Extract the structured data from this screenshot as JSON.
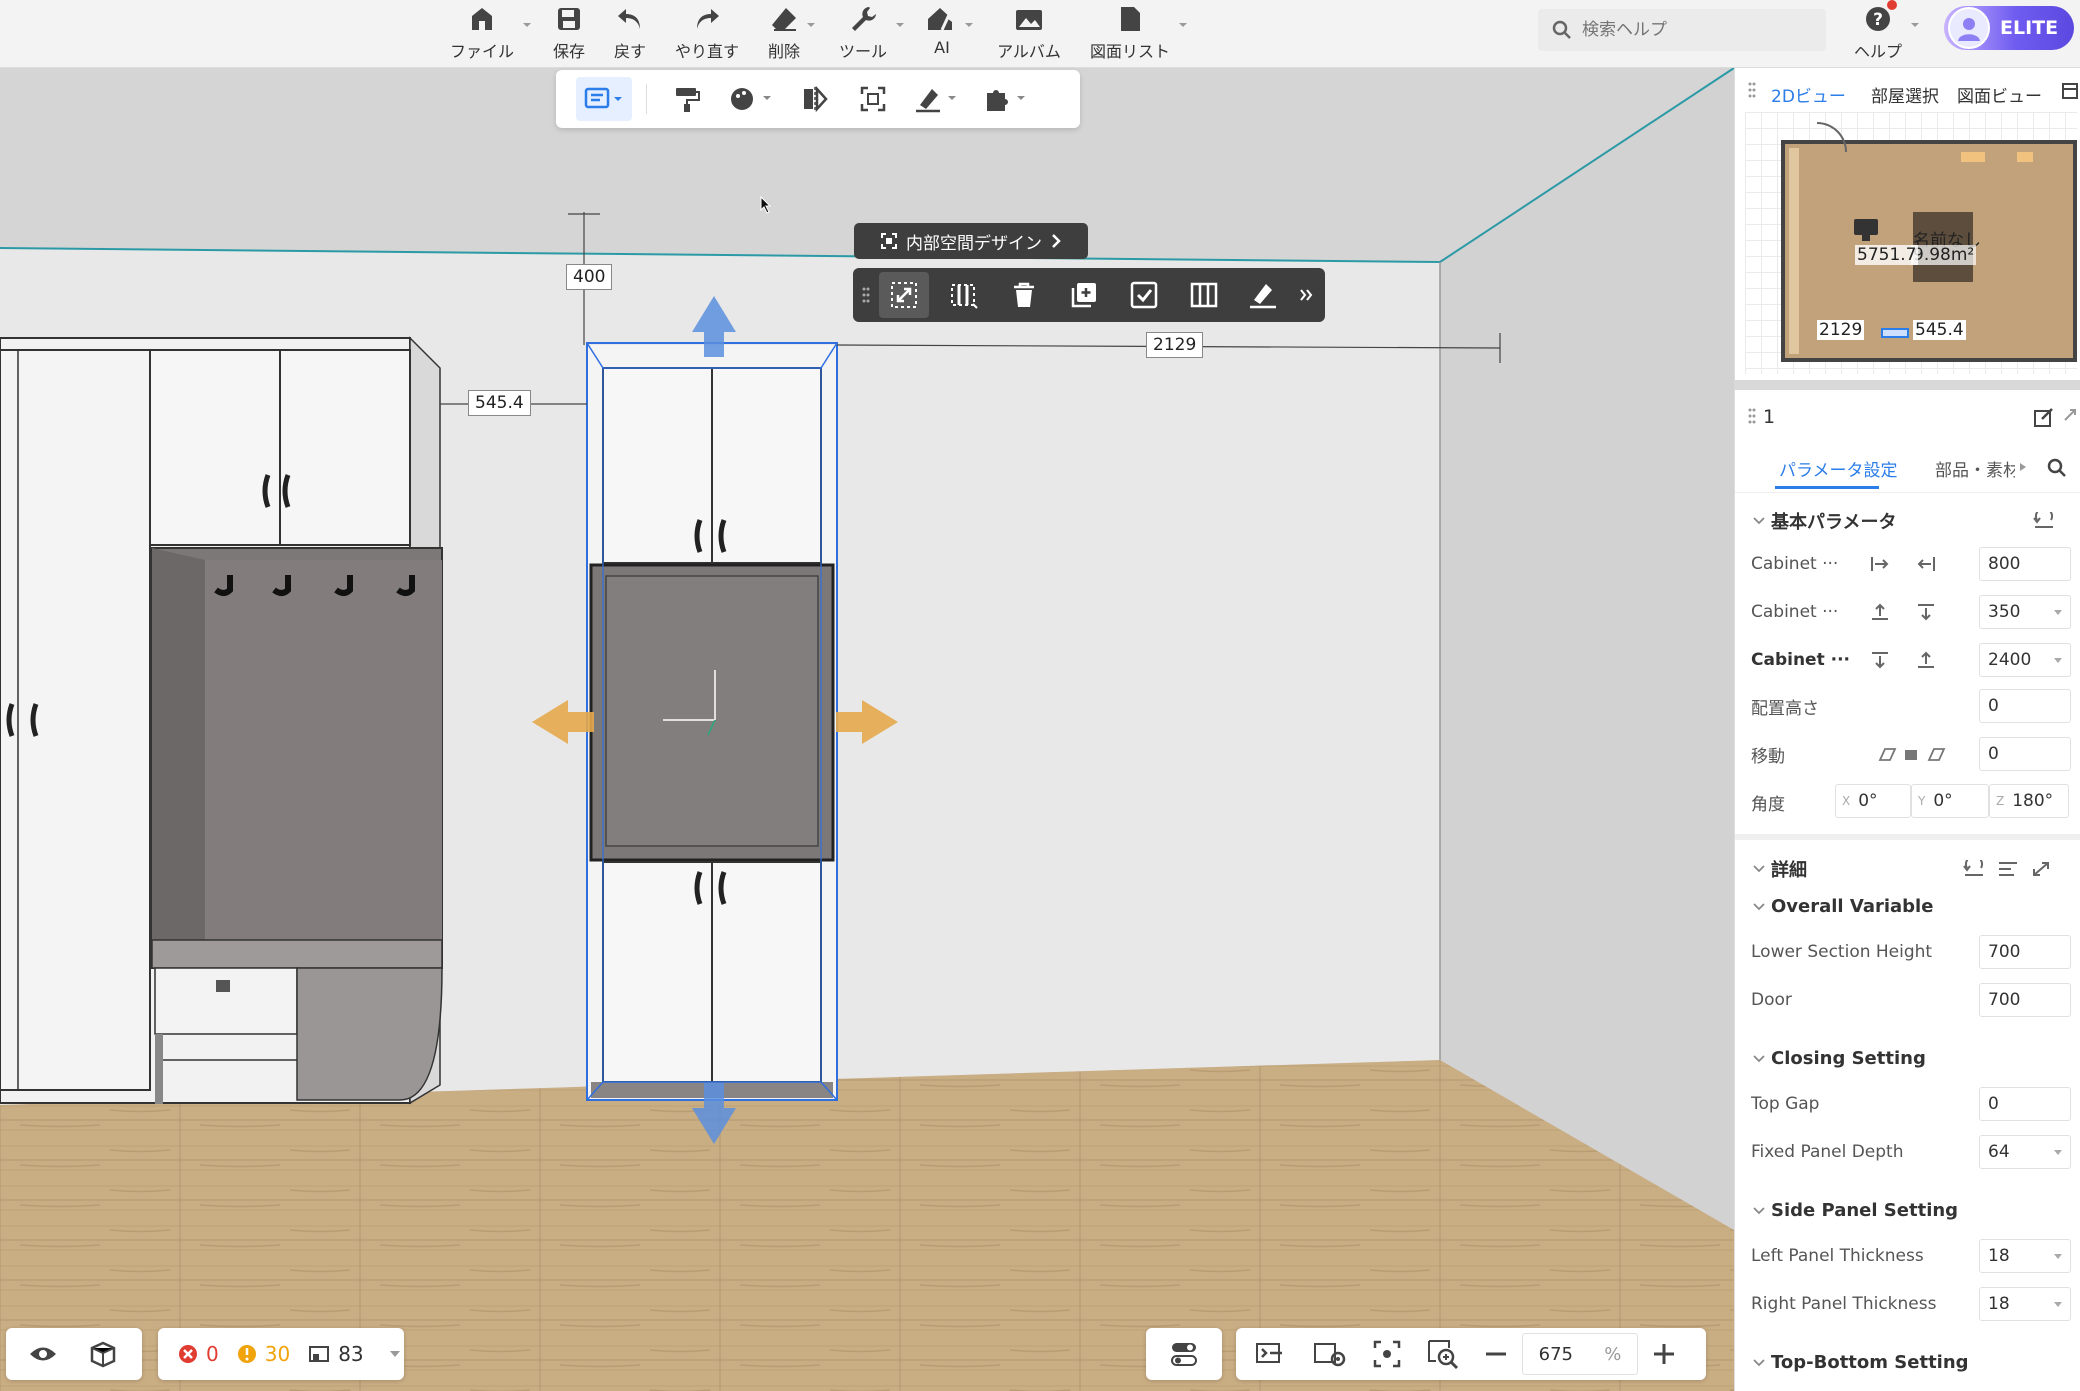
{
  "toolbar": {
    "items": [
      {
        "label": "ファイル",
        "icon": "home-icon"
      },
      {
        "label": "保存",
        "icon": "save-icon"
      },
      {
        "label": "戻す",
        "icon": "undo-icon"
      },
      {
        "label": "やり直す",
        "icon": "redo-icon"
      },
      {
        "label": "削除",
        "icon": "eraser-icon"
      },
      {
        "label": "ツール",
        "icon": "wrench-icon"
      },
      {
        "label": "AI",
        "icon": "ai-house-icon"
      },
      {
        "label": "アルバム",
        "icon": "album-icon"
      },
      {
        "label": "図面リスト",
        "icon": "drawing-list-icon"
      }
    ],
    "search_placeholder": "検索ヘルプ",
    "help_label": "ヘルプ",
    "elite_label": "ELITE"
  },
  "floating": {
    "design_label": "内部空間デザイン"
  },
  "dimensions": {
    "top_gap": "400",
    "left_gap": "545.4",
    "right_gap": "2129"
  },
  "minimap": {
    "tabs": [
      "2Dビュー",
      "部屋選択",
      "図面ビュー"
    ],
    "room_name": "名前なし",
    "room_area": "9.98m²",
    "room_dim": "5751.7",
    "left_dim": "2129",
    "right_dim": "545.4"
  },
  "panel": {
    "title": "1",
    "tabs": [
      "パラメータ設定",
      "部品・素材"
    ],
    "basic_section": "基本パラメータ",
    "basic_rows": [
      {
        "label": "Cabinet ···",
        "value": "800"
      },
      {
        "label": "Cabinet ···",
        "value": "350"
      },
      {
        "label": "Cabinet ···",
        "value": "2400"
      },
      {
        "label": "配置高さ",
        "value": "0"
      },
      {
        "label": "移動",
        "value": "0"
      }
    ],
    "angle_label": "角度",
    "angle": {
      "x": "0°",
      "y": "0°",
      "z": "180°"
    },
    "detail_section": "詳細",
    "groups": [
      {
        "title": "Overall Variable",
        "rows": [
          {
            "label": "Lower Section Height",
            "value": "700"
          },
          {
            "label": "Door",
            "value": "700"
          }
        ]
      },
      {
        "title": "Closing Setting",
        "rows": [
          {
            "label": "Top Gap",
            "value": "0"
          },
          {
            "label": "Fixed Panel Depth",
            "value": "64"
          }
        ]
      },
      {
        "title": "Side Panel Setting",
        "rows": [
          {
            "label": "Left Panel Thickness",
            "value": "18"
          },
          {
            "label": "Right Panel Thickness",
            "value": "18"
          }
        ]
      },
      {
        "title": "Top-Bottom Setting",
        "rows": []
      }
    ]
  },
  "status": {
    "errors": "0",
    "warnings": "30",
    "items": "83"
  },
  "zoom": {
    "value": "675",
    "unit": "%"
  },
  "colors": {
    "accent": "#2b7de9",
    "selection": "#2f6fe0",
    "warning": "#f0a30a",
    "error": "#e03c31",
    "elite": "#6f5cf0"
  }
}
